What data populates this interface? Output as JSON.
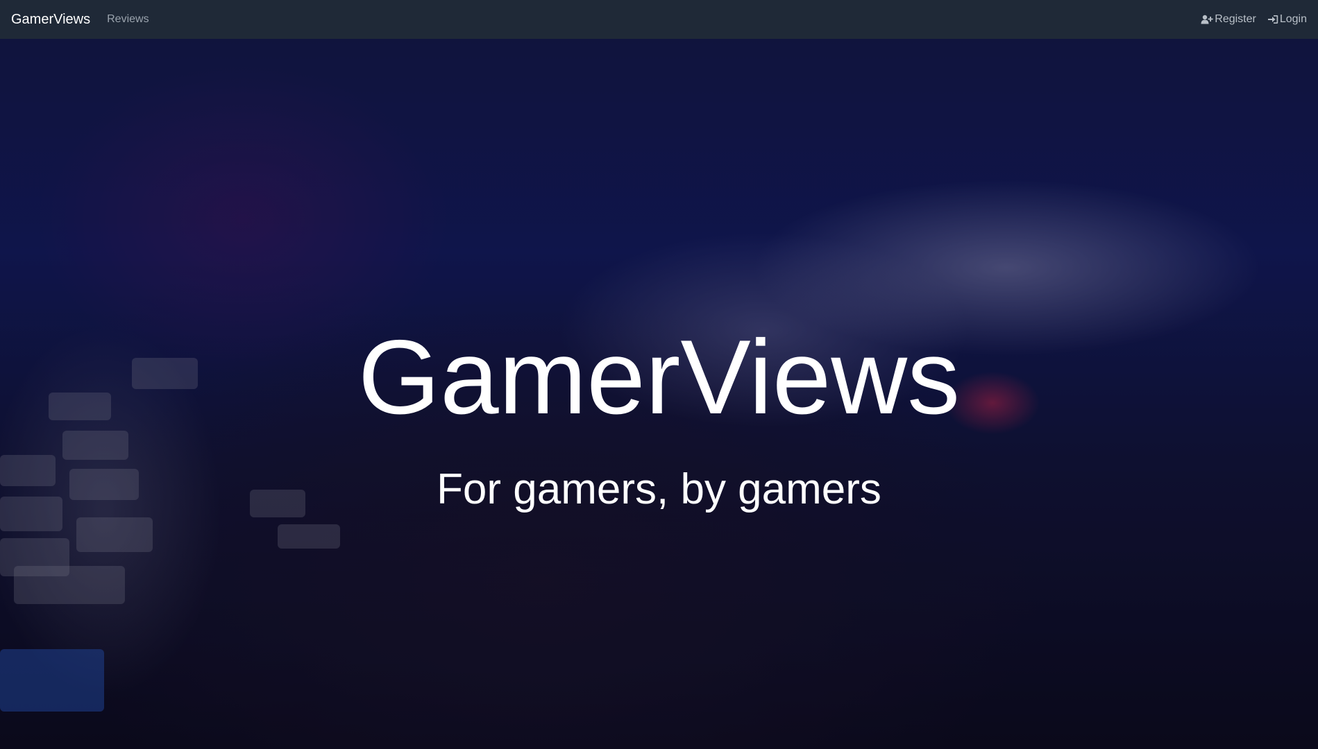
{
  "navbar": {
    "brand": "GamerViews",
    "links": {
      "reviews": "Reviews",
      "register": "Register",
      "login": "Login"
    },
    "icons": {
      "register": "user-plus-icon",
      "login": "sign-in-icon"
    }
  },
  "hero": {
    "title": "GamerViews",
    "tagline": "For gamers, by gamers",
    "background_image": "blurred keyboard with hand in blue and red lighting"
  },
  "colors": {
    "navbar_bg": "#1f2937",
    "nav_link": "#9aa3ad",
    "hero_text": "#ffffff"
  }
}
